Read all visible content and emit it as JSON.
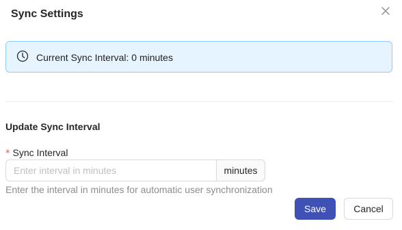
{
  "dialog": {
    "title": "Sync Settings"
  },
  "info": {
    "text": "Current Sync Interval: 0 minutes"
  },
  "form": {
    "section_title": "Update Sync Interval",
    "required_mark": "*",
    "field_label": "Sync Interval",
    "input_value": "",
    "input_placeholder": "Enter interval in minutes",
    "addon_label": "minutes",
    "help_text": "Enter the interval in minutes for automatic user synchronization"
  },
  "footer": {
    "save_label": "Save",
    "cancel_label": "Cancel"
  },
  "colors": {
    "primary": "#3f51b5",
    "info_bg": "#e6f4ff",
    "info_border": "#91caff",
    "required": "#ff4d4f"
  },
  "icons": {
    "close": "close-icon",
    "info": "clock-icon"
  }
}
